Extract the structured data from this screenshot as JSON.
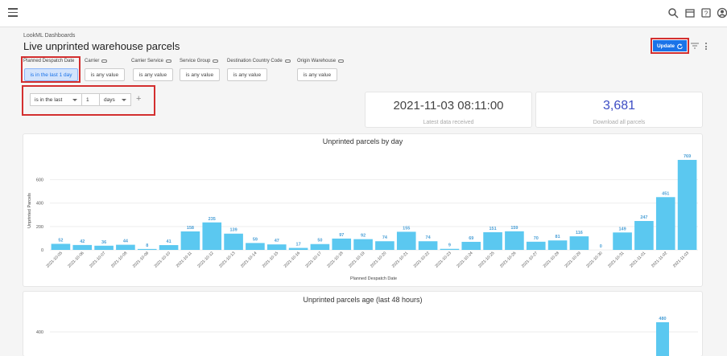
{
  "header": {
    "breadcrumb": "LookML Dashboards",
    "title": "Live unprinted warehouse parcels",
    "update_label": "Update"
  },
  "filters": [
    {
      "label": "Planned Despatch Date",
      "value": "is in the last 1 day"
    },
    {
      "label": "Carrier",
      "value": "is any value"
    },
    {
      "label": "Carrier Service",
      "value": "is any value"
    },
    {
      "label": "Service Group",
      "value": "is any value"
    },
    {
      "label": "Destination Country Code",
      "value": "is any value"
    },
    {
      "label": "Origin Warehouse",
      "value": "is any value"
    }
  ],
  "filter_editor": {
    "operator": "is in the last",
    "amount": "1",
    "unit": "days",
    "add": "+"
  },
  "kpis": [
    {
      "value": "2021-11-03 08:11:00",
      "label": "Latest data received"
    },
    {
      "value": "3,681",
      "label": "Download all parcels"
    }
  ],
  "colors": {
    "accent": "#1a73e8",
    "bar": "#5bc8f0",
    "highlight": "#d32f2f",
    "kpi_link": "#3c4cc4"
  },
  "icons": [
    "menu-icon",
    "search-icon",
    "calendar-icon",
    "help-icon",
    "account-icon",
    "refresh-icon",
    "filter-icon",
    "more-vert-icon",
    "link-icon"
  ],
  "chart_data": [
    {
      "type": "bar",
      "title": "Unprinted parcels by day",
      "xlabel": "Planned Despatch Date",
      "ylabel": "Unprinted Parcels",
      "categories": [
        "2021-10-05",
        "2021-10-06",
        "2021-10-07",
        "2021-10-08",
        "2021-10-09",
        "2021-10-10",
        "2021-10-11",
        "2021-10-12",
        "2021-10-13",
        "2021-10-14",
        "2021-10-15",
        "2021-10-16",
        "2021-10-17",
        "2021-10-18",
        "2021-10-19",
        "2021-10-20",
        "2021-10-21",
        "2021-10-22",
        "2021-10-23",
        "2021-10-24",
        "2021-10-25",
        "2021-10-26",
        "2021-10-27",
        "2021-10-28",
        "2021-10-29",
        "2021-10-30",
        "2021-10-31",
        "2021-11-01",
        "2021-11-02",
        "2021-11-03"
      ],
      "values": [
        52,
        42,
        36,
        44,
        8,
        41,
        158,
        235,
        139,
        59,
        47,
        17,
        50,
        97,
        92,
        74,
        155,
        74,
        9,
        69,
        151,
        159,
        70,
        81,
        116,
        0,
        149,
        247,
        451,
        769
      ],
      "yticks": [
        0,
        200,
        400,
        600
      ],
      "ylim": [
        0,
        800
      ]
    },
    {
      "type": "bar",
      "title": "Unprinted parcels age (last 48 hours)",
      "yticks": [
        400
      ],
      "values": [
        480
      ]
    }
  ]
}
